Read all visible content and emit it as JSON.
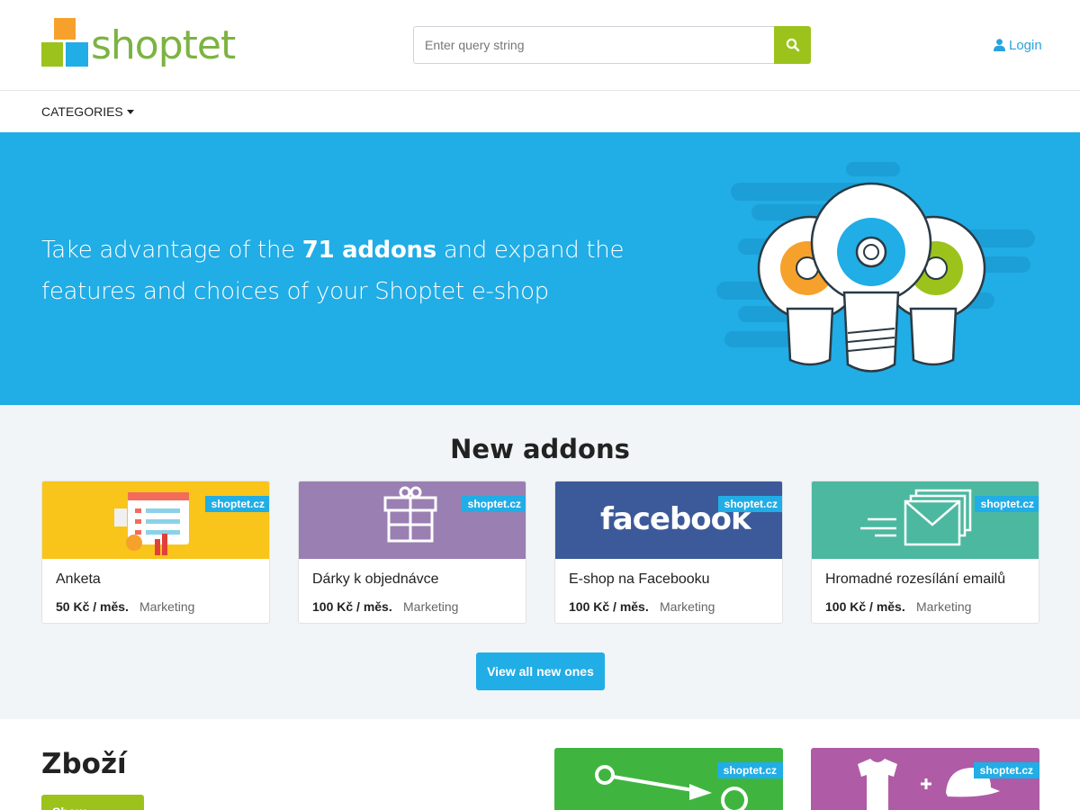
{
  "header": {
    "logo_text": "shoptet",
    "search_placeholder": "Enter query string",
    "login_label": "Login"
  },
  "nav": {
    "categories_label": "CATEGORIES"
  },
  "hero": {
    "text_before": "Take advantage of the ",
    "text_bold": "71 addons",
    "text_after": " and expand the features and choices of your Shoptet e-shop"
  },
  "new_addons": {
    "title": "New addons",
    "cards": [
      {
        "name": "Anketa",
        "price": "50 Kč / měs.",
        "category": "Marketing",
        "badge": "shoptet.cz",
        "color": "#f9c51a"
      },
      {
        "name": "Dárky k objednávce",
        "price": "100 Kč / měs.",
        "category": "Marketing",
        "badge": "shoptet.cz",
        "color": "#9a7fb2"
      },
      {
        "name": "E-shop na Facebooku",
        "price": "100 Kč / měs.",
        "category": "Marketing",
        "badge": "shoptet.cz",
        "color": "#3c5a99",
        "logo_word": "facebook"
      },
      {
        "name": "Hromadné rozesílání emailů",
        "price": "100 Kč / měs.",
        "category": "Marketing",
        "badge": "shoptet.cz",
        "color": "#4cb8a0"
      }
    ],
    "view_all_label": "View all new ones"
  },
  "zbozi": {
    "title": "Zboží",
    "button_label": "Show addons",
    "cards": [
      {
        "badge": "shoptet.cz",
        "color": "#3fb540"
      },
      {
        "badge": "shoptet.cz",
        "color": "#b05ba6"
      }
    ]
  },
  "colors": {
    "brand_green": "#9bc31c",
    "brand_blue": "#21ade6",
    "logo_orange": "#f6a12b"
  }
}
